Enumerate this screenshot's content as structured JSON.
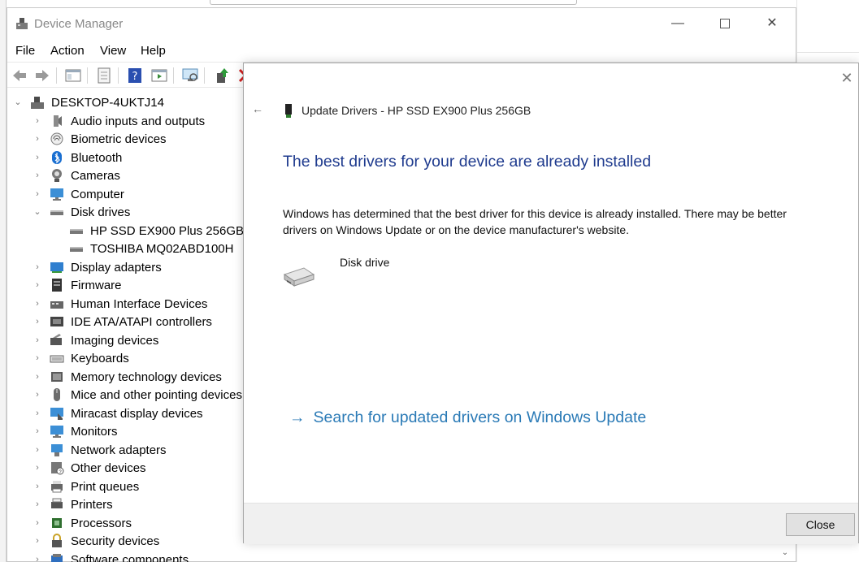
{
  "window": {
    "title": "Device Manager",
    "minimize": "—",
    "close": "✕"
  },
  "menu": [
    "File",
    "Action",
    "View",
    "Help"
  ],
  "toolbar": [
    "back-icon",
    "forward-icon",
    "show-hide-console-tree-icon",
    "properties-icon",
    "help-icon",
    "action-pane-icon",
    "scan-hardware-icon",
    "update-driver-icon",
    "uninstall-icon"
  ],
  "tree": {
    "root": "DESKTOP-4UKTJ14",
    "categories": [
      "Audio inputs and outputs",
      "Biometric devices",
      "Bluetooth",
      "Cameras",
      "Computer",
      "Disk drives",
      "Display adapters",
      "Firmware",
      "Human Interface Devices",
      "IDE ATA/ATAPI controllers",
      "Imaging devices",
      "Keyboards",
      "Memory technology devices",
      "Mice and other pointing devices",
      "Miracast display devices",
      "Monitors",
      "Network adapters",
      "Other devices",
      "Print queues",
      "Printers",
      "Processors",
      "Security devices",
      "Software components"
    ],
    "disk_children": [
      "HP SSD EX900 Plus 256GB",
      "TOSHIBA MQ02ABD100H"
    ]
  },
  "dialog": {
    "close_x": "✕",
    "back": "←",
    "title": "Update Drivers - HP SSD EX900 Plus 256GB",
    "heading": "The best drivers for your device are already installed",
    "body": "Windows has determined that the best driver for this device is already installed. There may be better drivers on Windows Update or on the device manufacturer's website.",
    "device_type": "Disk drive",
    "link_arrow": "→",
    "link": "Search for updated drivers on Windows Update",
    "close_button": "Close"
  },
  "colors": {
    "heading": "#1f3b8e",
    "link": "#2a7ab6",
    "footer": "#f0f0f0"
  }
}
